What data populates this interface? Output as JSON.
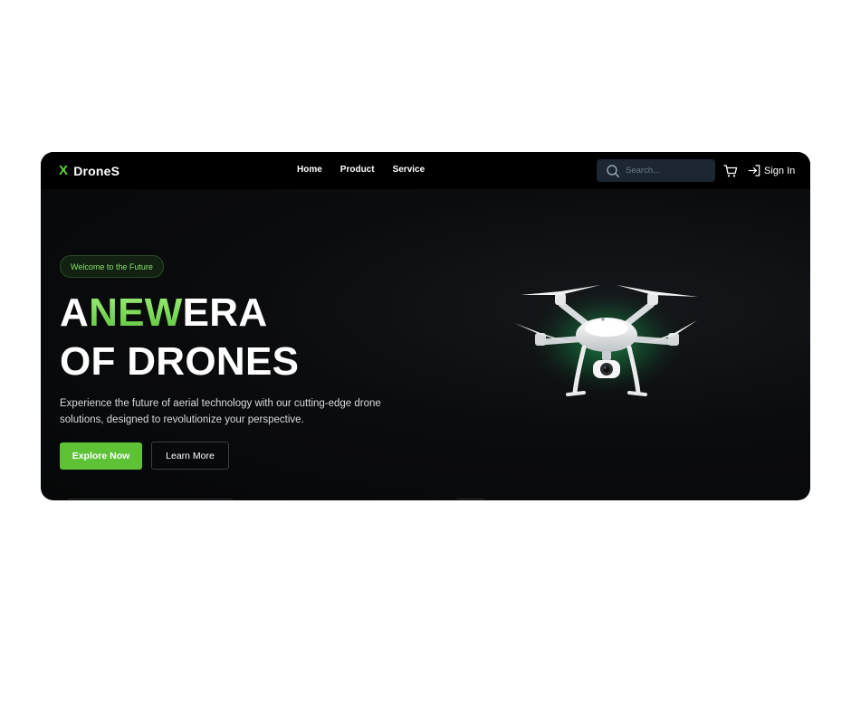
{
  "navbar": {
    "logo_mark": "X",
    "logo_text": "DroneS",
    "links": [
      "Home",
      "Product",
      "Service"
    ],
    "search_placeholder": "Search...",
    "cart_icon": "cart-icon",
    "signin_label": "Sign In",
    "signin_icon": "sign-in-icon"
  },
  "hero": {
    "badge": "Welcome to the Future",
    "headline_line1_a": "A",
    "headline_line1_b": "NEW",
    "headline_line1_c": "ERA",
    "headline_line2": "OF DRONES",
    "subtitle": "Experience the future of aerial technology with our cutting-edge drone solutions, designed to revolutionize your perspective.",
    "primary_button": "Explore Now",
    "secondary_button": "Learn More",
    "image": "drone-image"
  },
  "colors": {
    "accent": "#5dc236",
    "navbar_bg": "#000000",
    "hero_bg": "#0b0c0e",
    "search_bg": "#1c2733"
  }
}
